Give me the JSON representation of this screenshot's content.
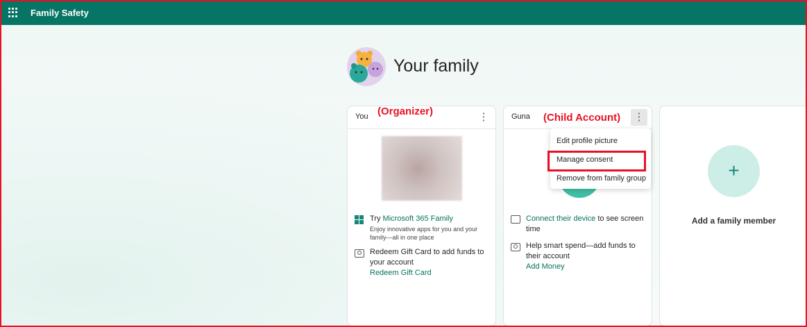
{
  "header": {
    "app_title": "Family Safety",
    "waffle_icon": "waffle-icon"
  },
  "page": {
    "title": "Your family"
  },
  "annotations": {
    "organizer": "(Organizer)",
    "child": "(Child Account)"
  },
  "cards": {
    "you": {
      "name": "You",
      "more_icon": "⋮",
      "promo": {
        "prefix": "Try ",
        "link": "Microsoft 365 Family",
        "description": "Enjoy innovative apps for you and your family—all in one place"
      },
      "gift": {
        "text": "Redeem Gift Card to add funds to your account",
        "link": "Redeem Gift Card"
      }
    },
    "child": {
      "name": "Guna",
      "more_icon": "⋮",
      "device": {
        "link": "Connect their device",
        "suffix": " to see screen time"
      },
      "spend": {
        "text": "Help smart spend—add funds to their account",
        "link": "Add Money"
      }
    },
    "add": {
      "plus": "+",
      "label": "Add a family member"
    }
  },
  "context_menu": {
    "items": [
      "Edit profile picture",
      "Manage consent",
      "Remove from family group"
    ],
    "highlighted": "Manage consent"
  },
  "colors": {
    "brand": "#077565",
    "accent": "#17857a",
    "annotation": "#e81123"
  }
}
